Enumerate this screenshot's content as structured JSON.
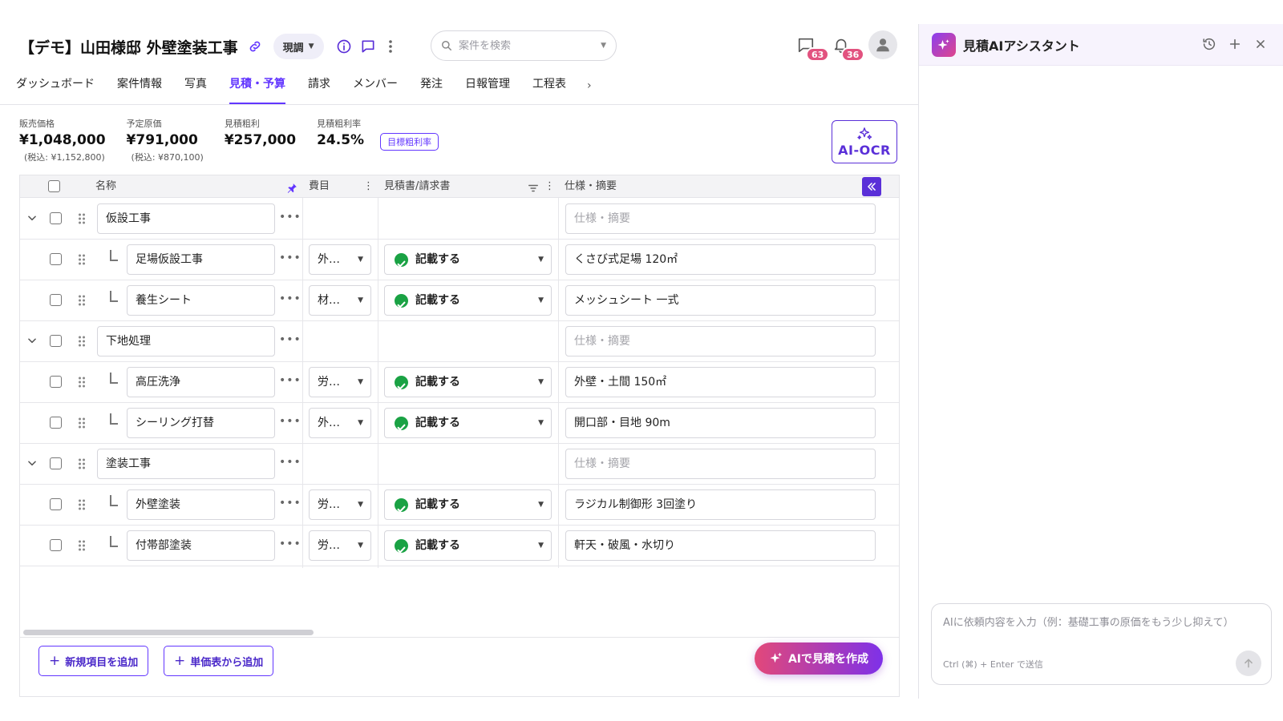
{
  "header": {
    "title": "【デモ】山田様邸 外壁塗装工事",
    "status": "現調",
    "search_placeholder": "案件を検索",
    "messages_count": "63",
    "notifications_count": "36"
  },
  "tabs": [
    {
      "label": "ダッシュボード"
    },
    {
      "label": "案件情報"
    },
    {
      "label": "写真"
    },
    {
      "label": "見積・予算",
      "active": true
    },
    {
      "label": "請求"
    },
    {
      "label": "メンバー"
    },
    {
      "label": "発注"
    },
    {
      "label": "日報管理"
    },
    {
      "label": "工程表"
    }
  ],
  "tabs_more": "›",
  "summary": {
    "sale_price": {
      "label": "販売価格",
      "value": "¥1,048,000",
      "tax": "(税込: ¥1,152,800)"
    },
    "planned_cost": {
      "label": "予定原価",
      "value": "¥791,000",
      "tax": "(税込: ¥870,100)"
    },
    "gross_profit": {
      "label": "見積粗利",
      "value": "¥257,000"
    },
    "profit_rate": {
      "label": "見積粗利率",
      "value": "24.5%"
    },
    "target_button": "目標粗利率",
    "ocr_button": "AI-OCR"
  },
  "table": {
    "columns": {
      "name": "名称",
      "category": "費目",
      "document": "見積書/請求書",
      "spec": "仕様・摘要"
    },
    "spec_placeholder": "仕様・摘要",
    "rows": [
      {
        "group": true,
        "name": "仮設工事",
        "category": "",
        "doc": "",
        "spec": ""
      },
      {
        "group": false,
        "name": "足場仮設工事",
        "category": "外…",
        "doc": "記載する",
        "spec": "くさび式足場 120㎡"
      },
      {
        "group": false,
        "name": "養生シート",
        "category": "材…",
        "doc": "記載する",
        "spec": "メッシュシート 一式"
      },
      {
        "group": true,
        "name": "下地処理",
        "category": "",
        "doc": "",
        "spec": ""
      },
      {
        "group": false,
        "name": "高圧洗浄",
        "category": "労…",
        "doc": "記載する",
        "spec": "外壁・土間 150㎡"
      },
      {
        "group": false,
        "name": "シーリング打替",
        "category": "外…",
        "doc": "記載する",
        "spec": "開口部・目地 90m"
      },
      {
        "group": true,
        "name": "塗装工事",
        "category": "",
        "doc": "",
        "spec": ""
      },
      {
        "group": false,
        "name": "外壁塗装",
        "category": "労…",
        "doc": "記載する",
        "spec": "ラジカル制御形 3回塗り"
      },
      {
        "group": false,
        "name": "付帯部塗装",
        "category": "労…",
        "doc": "記載する",
        "spec": "軒天・破風・水切り"
      }
    ]
  },
  "footer": {
    "add_new": "新規項目を追加",
    "add_from_price_list": "単価表から追加",
    "ai_create": "AIで見積を作成"
  },
  "assistant": {
    "title": "見積AIアシスタント",
    "input_placeholder": "AIに依頼内容を入力（例：基礎工事の原価をもう少し抑えて）",
    "send_hint": "Ctrl (⌘) + Enter で送信"
  },
  "colors": {
    "accent": "#6236ff",
    "badge": "#e2527f",
    "ok": "#1aa244"
  }
}
